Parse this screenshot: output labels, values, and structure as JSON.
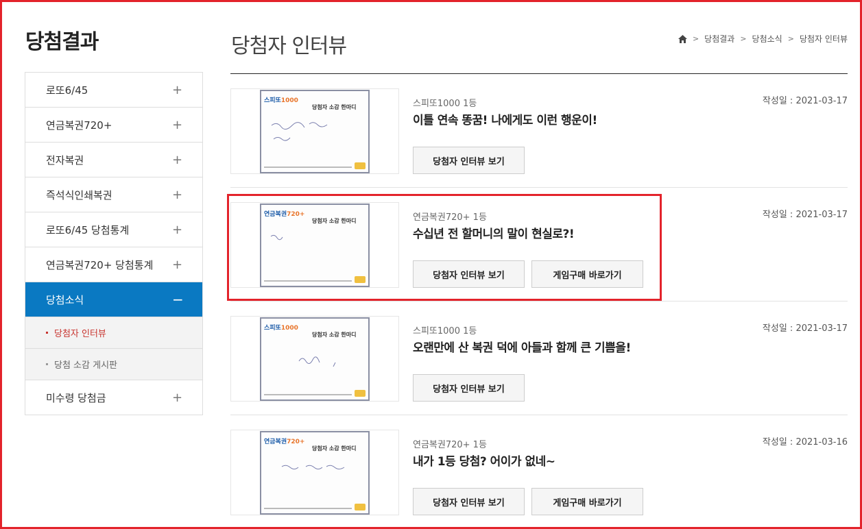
{
  "sidebar": {
    "title": "당첨결과",
    "items": [
      {
        "label": "로또6/45",
        "sign": "+"
      },
      {
        "label": "연금복권720+",
        "sign": "+"
      },
      {
        "label": "전자복권",
        "sign": "+"
      },
      {
        "label": "즉석식인쇄복권",
        "sign": "+"
      },
      {
        "label": "로또6/45 당첨통계",
        "sign": "+"
      },
      {
        "label": "연금복권720+ 당첨통계",
        "sign": "+"
      },
      {
        "label": "당첨소식",
        "sign": "−"
      }
    ],
    "sub_items": [
      {
        "label": "당첨자 인터뷰"
      },
      {
        "label": "당첨 소감 게시판"
      }
    ],
    "last_item": {
      "label": "미수령 당첨금",
      "sign": "+"
    }
  },
  "main": {
    "title": "당첨자 인터뷰",
    "breadcrumb": [
      "당첨결과",
      "당첨소식",
      "당첨자 인터뷰"
    ],
    "cards": [
      {
        "category": "스피또1000 1등",
        "headline": "이틀 연속 똥꿈! 나에게도 이런 행운이!",
        "date": "작성일 : 2021-03-17",
        "btn1": "당첨자 인터뷰 보기",
        "btn2": null,
        "logo": "스피또",
        "logo_suffix": "1000",
        "paper_head": "당첨자 소감 한마디"
      },
      {
        "category": "연금복권720+ 1등",
        "headline": "수십년 전 할머니의 말이 현실로?!",
        "date": "작성일 : 2021-03-17",
        "btn1": "당첨자 인터뷰 보기",
        "btn2": "게임구매 바로가기",
        "logo": "연금복권",
        "logo_suffix": "720+",
        "paper_head": "당첨자 소감 한마디"
      },
      {
        "category": "스피또1000 1등",
        "headline": "오랜만에 산 복권 덕에 아들과 함께 큰 기쁨을!",
        "date": "작성일 : 2021-03-17",
        "btn1": "당첨자 인터뷰 보기",
        "btn2": null,
        "logo": "스피또",
        "logo_suffix": "1000",
        "paper_head": "당첨자 소감 한마디"
      },
      {
        "category": "연금복권720+ 1등",
        "headline": "내가 1등 당첨? 어이가 없네~",
        "date": "작성일 : 2021-03-16",
        "btn1": "당첨자 인터뷰 보기",
        "btn2": "게임구매 바로가기",
        "logo": "연금복권",
        "logo_suffix": "720+",
        "paper_head": "당첨자 소감 한마디"
      }
    ]
  },
  "colors": {
    "accent": "#0a79c2",
    "current": "#c8342f",
    "highlight": "#e3232b"
  }
}
